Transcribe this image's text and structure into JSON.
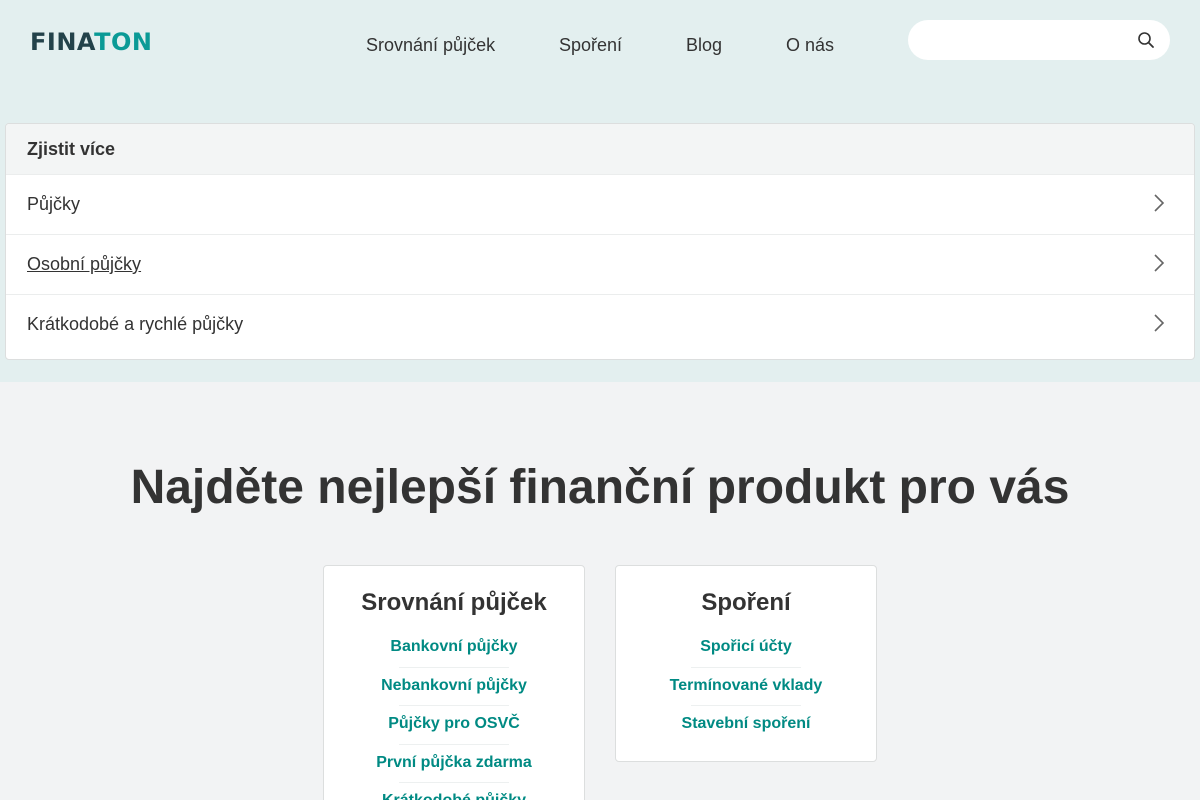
{
  "logo": {
    "part1": "FINA",
    "part2": "TON"
  },
  "nav": [
    {
      "label": "Srovnání půjček"
    },
    {
      "label": "Spoření"
    },
    {
      "label": "Blog"
    },
    {
      "label": "O nás"
    }
  ],
  "search": {
    "value": "",
    "placeholder": "",
    "icon": "search-icon"
  },
  "panel": {
    "heading": "Zjistit více",
    "items": [
      {
        "label": "Půjčky"
      },
      {
        "label": "Osobní půjčky"
      },
      {
        "label": "Krátkodobé a rychlé půjčky"
      }
    ]
  },
  "main": {
    "headline": "Najděte nejlepší finanční produkt pro vás",
    "cards": [
      {
        "title": "Srovnání půjček",
        "links": [
          "Bankovní půjčky",
          "Nebankovní půjčky",
          "Půjčky pro OSVČ",
          "První půjčka zdarma",
          "Krátkodobé půjčky"
        ]
      },
      {
        "title": "Spoření",
        "links": [
          "Spořicí účty",
          "Termínované vklady",
          "Stavební spoření"
        ]
      }
    ]
  },
  "colors": {
    "brand_dark": "#23424a",
    "brand_teal": "#0a9a96",
    "link": "#008a83",
    "hero_bg": "#e3efef",
    "page_bg": "#f2f3f4"
  }
}
